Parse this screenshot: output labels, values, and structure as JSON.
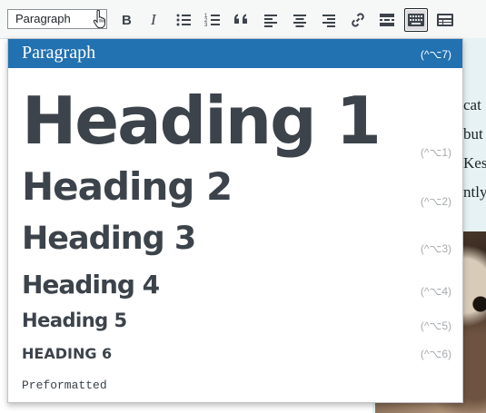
{
  "toolbar": {
    "format_select": "Paragraph",
    "buttons": [
      {
        "name": "bold-button",
        "icon": "bold-icon"
      },
      {
        "name": "italic-button",
        "icon": "italic-icon"
      },
      {
        "name": "bulleted-list-button",
        "icon": "bulleted-list-icon"
      },
      {
        "name": "numbered-list-button",
        "icon": "numbered-list-icon"
      },
      {
        "name": "blockquote-button",
        "icon": "quote-icon"
      },
      {
        "name": "align-left-button",
        "icon": "align-left-icon"
      },
      {
        "name": "align-center-button",
        "icon": "align-center-icon"
      },
      {
        "name": "align-right-button",
        "icon": "align-right-icon"
      },
      {
        "name": "insert-link-button",
        "icon": "link-icon"
      },
      {
        "name": "read-more-button",
        "icon": "read-more-icon"
      },
      {
        "name": "toolbar-toggle-button",
        "icon": "keyboard-icon",
        "active": true
      },
      {
        "name": "form-button",
        "icon": "form-icon"
      }
    ]
  },
  "dropdown": {
    "items": [
      {
        "label": "Paragraph",
        "shortcut": "(^⌥7)",
        "selected": true
      },
      {
        "label": "Heading 1",
        "shortcut": "(^⌥1)"
      },
      {
        "label": "Heading 2",
        "shortcut": "(^⌥2)"
      },
      {
        "label": "Heading 3",
        "shortcut": "(^⌥3)"
      },
      {
        "label": "Heading 4",
        "shortcut": "(^⌥4)"
      },
      {
        "label": "Heading 5",
        "shortcut": "(^⌥5)"
      },
      {
        "label": "HEADING 6",
        "shortcut": "(^⌥6)"
      },
      {
        "label": "Preformatted",
        "shortcut": ""
      }
    ]
  },
  "editor": {
    "text_fragments": [
      "cat",
      "but",
      "Kesn",
      "ntly"
    ]
  },
  "colors": {
    "selected_bg": "#2271b1",
    "editor_bg": "#e6f2f3",
    "heading_text": "#3c434a"
  }
}
